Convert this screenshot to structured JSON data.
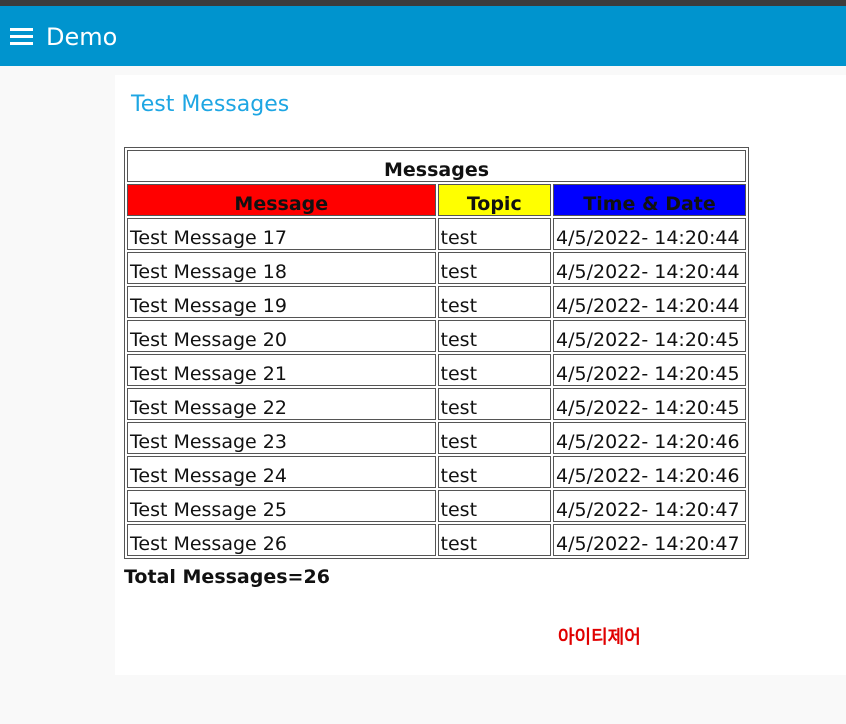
{
  "app": {
    "title": "Demo"
  },
  "panel": {
    "title": "Test Messages"
  },
  "table": {
    "caption": "Messages",
    "columns": [
      "Message",
      "Topic",
      "Time & Date"
    ],
    "header_colors": [
      "#ff0000",
      "#ffff00",
      "#0000ff"
    ],
    "rows": [
      [
        "Test Message 17",
        "test",
        "4/5/2022- 14:20:44"
      ],
      [
        "Test Message 18",
        "test",
        "4/5/2022- 14:20:44"
      ],
      [
        "Test Message 19",
        "test",
        "4/5/2022- 14:20:44"
      ],
      [
        "Test Message 20",
        "test",
        "4/5/2022- 14:20:45"
      ],
      [
        "Test Message 21",
        "test",
        "4/5/2022- 14:20:45"
      ],
      [
        "Test Message 22",
        "test",
        "4/5/2022- 14:20:45"
      ],
      [
        "Test Message 23",
        "test",
        "4/5/2022- 14:20:46"
      ],
      [
        "Test Message 24",
        "test",
        "4/5/2022- 14:20:46"
      ],
      [
        "Test Message 25",
        "test",
        "4/5/2022- 14:20:47"
      ],
      [
        "Test Message 26",
        "test",
        "4/5/2022- 14:20:47"
      ]
    ]
  },
  "footer": {
    "total_text": "Total Messages=26",
    "brand_text": "아이티제어"
  },
  "colors": {
    "appbar": "#0094ce",
    "panel_title": "#1ea6e3",
    "brand_text": "#e00000"
  },
  "icons": {
    "menu": "menu-icon"
  }
}
